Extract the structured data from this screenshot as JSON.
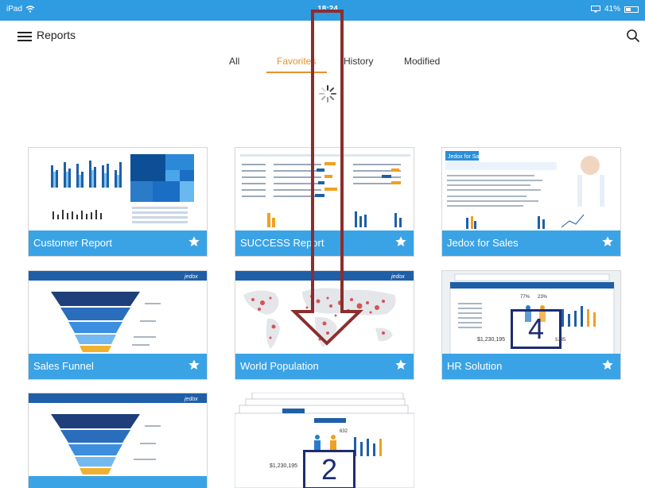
{
  "status_bar": {
    "device": "iPad",
    "time": "18:24",
    "battery": "41%"
  },
  "header": {
    "title": "Reports"
  },
  "tabs": [
    {
      "label": "All",
      "active": false
    },
    {
      "label": "Favorites",
      "active": true
    },
    {
      "label": "History",
      "active": false
    },
    {
      "label": "Modified",
      "active": false
    }
  ],
  "reports": [
    {
      "title": "Customer Report",
      "favorite": true
    },
    {
      "title": "SUCCESS Report",
      "favorite": true
    },
    {
      "title": "Jedox for Sales",
      "favorite": true
    },
    {
      "title": "Sales Funnel",
      "favorite": true
    },
    {
      "title": "World Population",
      "favorite": true
    },
    {
      "title": "HR Solution",
      "favorite": true
    },
    {
      "title": "",
      "favorite": true
    },
    {
      "title": "",
      "favorite": true
    }
  ],
  "thumb_text": {
    "jedox_logo": "jedox",
    "jedox_for_sales_banner": "Jedox for Sales",
    "hr_pct_1": "77%",
    "hr_pct_2": "23%",
    "hr_amount_1": "$1,230,195",
    "hr_amount_2": "$235",
    "hr2_value": "632",
    "hr2_amount": "$1,230,195"
  },
  "annotations": {
    "badge_hr": "4",
    "badge_stack": "2"
  },
  "colors": {
    "accent_blue": "#3aa3e6",
    "status_blue": "#2f9be0",
    "favorites_orange": "#e8912d",
    "arrow_red": "#8b2e2e",
    "badge_navy": "#1e2c6f"
  },
  "icons": {
    "menu": "hamburger-icon",
    "search": "search-icon",
    "star": "star-icon",
    "spinner": "loading-spinner-icon"
  }
}
